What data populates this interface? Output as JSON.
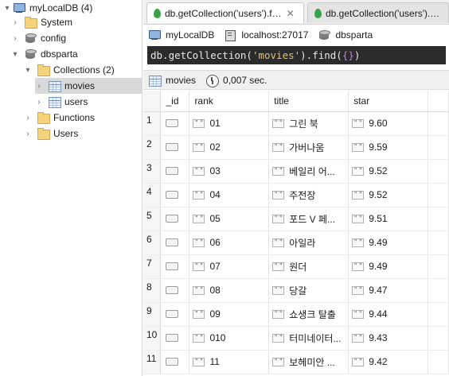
{
  "tree": {
    "connection": "myLocalDB (4)",
    "system": "System",
    "config": "config",
    "dbsparta": "dbsparta",
    "collections": "Collections (2)",
    "movies": "movies",
    "users": "users",
    "functions": "Functions",
    "usersFolder": "Users"
  },
  "tabs": [
    {
      "label": "db.getCollection('users').f…"
    },
    {
      "label": "db.getCollection('users').…"
    }
  ],
  "info": {
    "connection": "myLocalDB",
    "host": "localhost:27017",
    "database": "dbsparta"
  },
  "query": {
    "prefix": "db.getCollection(",
    "arg": "'movies'",
    "middle": ").find(",
    "braces": "{}",
    "suffix": ")"
  },
  "result": {
    "collection": "movies",
    "time": "0,007 sec."
  },
  "grid": {
    "columns": [
      "_id",
      "rank",
      "title",
      "star"
    ],
    "rows": [
      {
        "n": "1",
        "rank": "01",
        "title": "그린 북",
        "star": "9.60"
      },
      {
        "n": "2",
        "rank": "02",
        "title": "가버나움",
        "star": "9.59"
      },
      {
        "n": "3",
        "rank": "03",
        "title": "베일리 어...",
        "star": "9.52"
      },
      {
        "n": "4",
        "rank": "04",
        "title": "주전장",
        "star": "9.52"
      },
      {
        "n": "5",
        "rank": "05",
        "title": "포드 V 페...",
        "star": "9.51"
      },
      {
        "n": "6",
        "rank": "06",
        "title": "아일라",
        "star": "9.49"
      },
      {
        "n": "7",
        "rank": "07",
        "title": "원더",
        "star": "9.49"
      },
      {
        "n": "8",
        "rank": "08",
        "title": "당갈",
        "star": "9.47"
      },
      {
        "n": "9",
        "rank": "09",
        "title": "쇼생크 탈출",
        "star": "9.44"
      },
      {
        "n": "10",
        "rank": "010",
        "title": "터미네이터...",
        "star": "9.43"
      },
      {
        "n": "11",
        "rank": "11",
        "title": "보헤미안 ...",
        "star": "9.42"
      }
    ]
  }
}
